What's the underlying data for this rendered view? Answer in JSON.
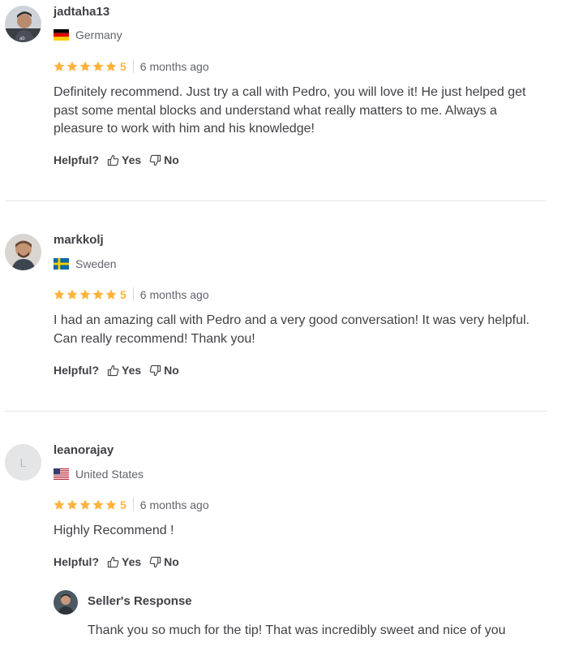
{
  "helpful": {
    "question": "Helpful?",
    "yes_label": "Yes",
    "no_label": "No"
  },
  "reviews": [
    {
      "username": "jadtaha13",
      "country": "Germany",
      "flag": "germany-flag",
      "avatar": "user-photo",
      "rating": "5",
      "time_ago": "6 months ago",
      "text": "Definitely recommend. Just try a call with Pedro, you will love it! He just helped get past some mental blocks and understand what really matters to me. Always a pleasure to work with him and his knowledge!"
    },
    {
      "username": "markkolj",
      "country": "Sweden",
      "flag": "sweden-flag",
      "avatar": "user-photo",
      "rating": "5",
      "time_ago": "6 months ago",
      "text": "I had an amazing call with Pedro and a very good conversation! It was very helpful. Can really recommend! Thank you!"
    },
    {
      "username": "leanorajay",
      "country": "United States",
      "flag": "usa-flag",
      "avatar_letter": "L",
      "rating": "5",
      "time_ago": "6 months ago",
      "text": "Highly Recommend !"
    }
  ],
  "seller_response": {
    "title": "Seller's Response",
    "text": "Thank you so much for the tip! That was incredibly sweet and nice of you"
  },
  "colors": {
    "star": "#ffb33e",
    "text": "#404145",
    "muted": "#62646a",
    "divider": "#e4e5e7"
  }
}
